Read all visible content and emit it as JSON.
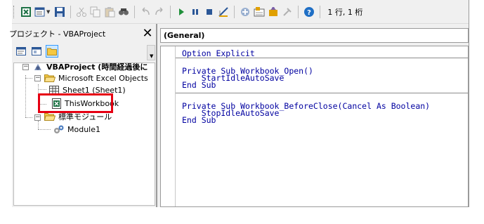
{
  "toolbar": {
    "position_text": "1 行, 1 桁",
    "buttons": [
      {
        "name": "view-excel-icon"
      },
      {
        "name": "insert-module-icon"
      },
      {
        "name": "save-icon"
      },
      {
        "name": "cut-icon"
      },
      {
        "name": "copy-icon"
      },
      {
        "name": "paste-icon"
      },
      {
        "name": "find-icon"
      },
      {
        "name": "undo-icon"
      },
      {
        "name": "redo-icon"
      },
      {
        "name": "run-icon"
      },
      {
        "name": "break-icon"
      },
      {
        "name": "reset-icon"
      },
      {
        "name": "design-mode-icon"
      },
      {
        "name": "project-explorer-icon"
      },
      {
        "name": "properties-icon"
      },
      {
        "name": "object-browser-icon"
      },
      {
        "name": "toolbox-icon"
      },
      {
        "name": "help-icon"
      }
    ]
  },
  "project_explorer": {
    "title": "プロジェクト - VBAProject",
    "close_label": "✕",
    "tree": {
      "project": "VBAProject (時間経過後に",
      "objects_folder": "Microsoft Excel Objects",
      "sheet1": "Sheet1 (Sheet1)",
      "this_workbook": "ThisWorkbook",
      "modules_folder": "標準モジュール",
      "module1": "Module1"
    }
  },
  "code_window": {
    "object_combo": "(General)",
    "declarations": "Option Explicit",
    "proc_open": "Private Sub Workbook_Open()\n    StartIdleAutoSave\nEnd Sub",
    "proc_close": "Private Sub Workbook_BeforeClose(Cancel As Boolean)\n    StopIdleAutoSave\nEnd Sub"
  },
  "colors": {
    "highlight": "#e60012",
    "code_keyword": "#0000a0",
    "selection": "#cde8ff"
  }
}
